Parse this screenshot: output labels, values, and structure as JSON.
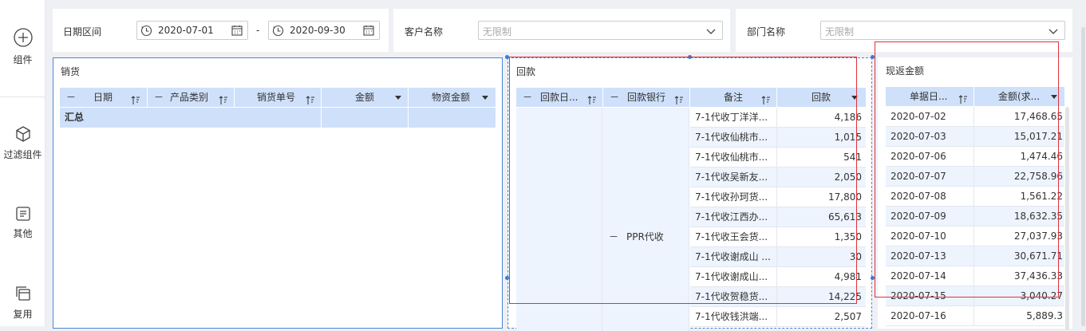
{
  "sidebar": {
    "items": [
      {
        "label": "组件",
        "icon": "add-circle-icon"
      },
      {
        "label": "过滤组件",
        "icon": "cube-icon"
      },
      {
        "label": "其他",
        "icon": "document-icon"
      },
      {
        "label": "复用",
        "icon": "copy-icon"
      }
    ]
  },
  "filters": {
    "date_label": "日期区间",
    "date_start": "2020-07-01",
    "date_end": "2020-09-30",
    "date_sep": "-",
    "customer_label": "客户名称",
    "customer_placeholder": "无限制",
    "dept_label": "部门名称",
    "dept_placeholder": "无限制"
  },
  "sales": {
    "title": "销货",
    "headers": [
      {
        "text": "日期",
        "collapse": "－",
        "sort": true
      },
      {
        "text": "产品类别",
        "collapse": "－",
        "sort": true
      },
      {
        "text": "销货单号",
        "sort": true
      },
      {
        "text": "金额",
        "dropdown": true
      },
      {
        "text": "物资金额",
        "dropdown": true
      }
    ],
    "summary": "汇总"
  },
  "payment": {
    "title": "回款",
    "headers": [
      {
        "text": "回款日...",
        "collapse": "－",
        "sort": true
      },
      {
        "text": "回款银行",
        "collapse": "－",
        "sort": true
      },
      {
        "text": "备注",
        "sort": true
      },
      {
        "text": "回款",
        "dropdown": true
      }
    ],
    "bank_collapse": "－",
    "bank": "PPR代收",
    "rows": [
      {
        "note": "7-1代收丁洋洋...",
        "amount": "4,186"
      },
      {
        "note": "7-1代收仙桃市...",
        "amount": "1,015"
      },
      {
        "note": "7-1代收仙桃市...",
        "amount": "541"
      },
      {
        "note": "7-1代收吴新友...",
        "amount": "2,050"
      },
      {
        "note": "7-1代收孙珂货...",
        "amount": "17,800"
      },
      {
        "note": "7-1代收江西办...",
        "amount": "65,613"
      },
      {
        "note": "7-1代收王会货...",
        "amount": "1,350"
      },
      {
        "note": "7-1代收谢成山 ...",
        "amount": "30"
      },
      {
        "note": "7-1代收谢成山...",
        "amount": "4,981"
      },
      {
        "note": "7-1代收贺稳货...",
        "amount": "14,225"
      },
      {
        "note": "7-1代收钱洪端...",
        "amount": "2,507"
      }
    ]
  },
  "rebate": {
    "title": "现返金额",
    "headers": [
      {
        "text": "单据日...",
        "sort": true
      },
      {
        "text": "金额(求...",
        "dropdown": true
      }
    ],
    "rows": [
      {
        "date": "2020-07-02",
        "amount": "17,468.65"
      },
      {
        "date": "2020-07-03",
        "amount": "15,017.21"
      },
      {
        "date": "2020-07-06",
        "amount": "1,474.46"
      },
      {
        "date": "2020-07-07",
        "amount": "22,758.96"
      },
      {
        "date": "2020-07-08",
        "amount": "1,561.22"
      },
      {
        "date": "2020-07-09",
        "amount": "18,632.35"
      },
      {
        "date": "2020-07-10",
        "amount": "27,037.93"
      },
      {
        "date": "2020-07-13",
        "amount": "30,671.71"
      },
      {
        "date": "2020-07-14",
        "amount": "37,436.33"
      },
      {
        "date": "2020-07-15",
        "amount": "3,040.27"
      },
      {
        "date": "2020-07-16",
        "amount": "5,889.3"
      }
    ]
  },
  "colors": {
    "header_bg": "#cfe0fa",
    "row_alt": "#eef4fd",
    "highlight": "#e0313b",
    "selection": "#3a7bd5"
  }
}
